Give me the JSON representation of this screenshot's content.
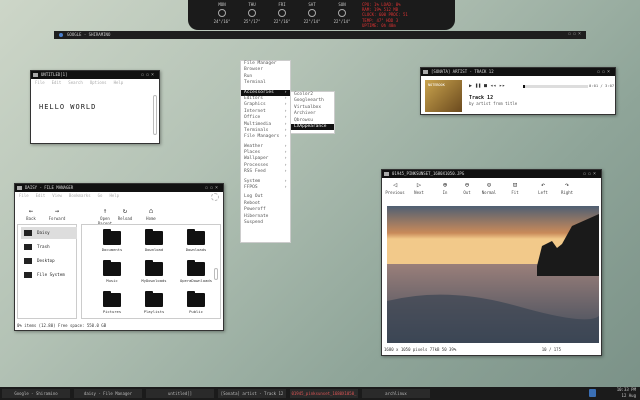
{
  "weather": {
    "days": [
      {
        "name": "MON",
        "temp": "24°/16°"
      },
      {
        "name": "THU",
        "temp": "25°/17°"
      },
      {
        "name": "FRI",
        "temp": "22°/16°"
      },
      {
        "name": "SAT",
        "temp": "22°/14°"
      },
      {
        "name": "SUN",
        "temp": "22°/14°"
      }
    ],
    "stats": [
      "CPU: 1%  LOAD: 0%",
      "RAM: 19%  512 MB",
      "CLOCK: 600  PROC: 51",
      "TEMP: 47°  HDD 3",
      "UPTIME: 0h 48m"
    ]
  },
  "google_bar": {
    "title": "GOOGLE - SHIRAMINO"
  },
  "untitled": {
    "title": "UNTITLED[1]",
    "menus": [
      "File",
      "Edit",
      "Search",
      "Options",
      "Help"
    ],
    "content": "HELLO WORLD"
  },
  "music": {
    "title": "[SONATA] ARTIST - TRACK 12",
    "track": "Track 12",
    "artist": "by artist from title",
    "time": "0:01 / 3:07",
    "progress": 0.03,
    "album_art_text": "NOTEBOOK"
  },
  "menu": {
    "items": [
      {
        "label": "File Manager",
        "arrow": false
      },
      {
        "label": "Browser",
        "arrow": false
      },
      {
        "label": "Run",
        "arrow": false
      },
      {
        "label": "Terminal",
        "arrow": false
      },
      {
        "sep": true
      },
      {
        "label": "Accessories",
        "arrow": true,
        "selected": true
      },
      {
        "label": "Editors",
        "arrow": true
      },
      {
        "label": "Graphics",
        "arrow": true
      },
      {
        "label": "Internet",
        "arrow": true
      },
      {
        "label": "Office",
        "arrow": true
      },
      {
        "label": "Multimedia",
        "arrow": true
      },
      {
        "label": "Terminals",
        "arrow": true
      },
      {
        "label": "File Managers",
        "arrow": true
      },
      {
        "sep": true
      },
      {
        "label": "Weather",
        "arrow": true
      },
      {
        "label": "Places",
        "arrow": true
      },
      {
        "label": "Wallpaper",
        "arrow": true
      },
      {
        "label": "Processes",
        "arrow": true
      },
      {
        "label": "RSS Feed",
        "arrow": true
      },
      {
        "sep": true
      },
      {
        "label": "System",
        "arrow": true
      },
      {
        "label": "FFPOS",
        "arrow": true
      },
      {
        "sep": true
      },
      {
        "label": "Log Out",
        "arrow": false
      },
      {
        "label": "Reboot",
        "arrow": false
      },
      {
        "label": "Poweroff",
        "arrow": false
      },
      {
        "label": "Hibernate",
        "arrow": false
      },
      {
        "label": "Suspend",
        "arrow": false
      }
    ],
    "submenu": [
      "Gcolor2",
      "Googleearth",
      "Virtualbox",
      "Archiver",
      "Qbrowsu",
      "LXAppearance"
    ]
  },
  "file_manager": {
    "title": "DAISY - FILE MANAGER",
    "menus": [
      "File",
      "Edit",
      "View",
      "Bookmarks",
      "Go",
      "Help"
    ],
    "toolbar": [
      "Back",
      "Forward",
      "Open Parent",
      "Reload",
      "Home"
    ],
    "sidebar": [
      "Daisy",
      "Trash",
      "Desktop",
      "File System"
    ],
    "folders": [
      "Documents",
      "Download",
      "Downloads",
      "Music",
      "MyDownloads",
      "OperaDownloads",
      "Pictures",
      "Playlists",
      "Public"
    ],
    "status": "0% items (12.80) Free space: 550.0 GB"
  },
  "image_viewer": {
    "title": "01945_PINKSUNSET_1680X1050.JPG",
    "toolbar": [
      "Previous",
      "Next",
      "In",
      "Out",
      "Normal",
      "Fit",
      "Left",
      "Right"
    ],
    "status_left": "1680 x 1050 pixels  77kB 50  39%",
    "status_right": "10 / 175"
  },
  "taskbar": {
    "tasks": [
      "Google - Shiramino",
      "daisy - File Manager",
      "untitled[]",
      "[Sonata] artist - Track 12",
      "01945_pinksunset_1680X1050_",
      "archlinux"
    ],
    "clock": "10:33 PM",
    "date": "12 Aug"
  }
}
